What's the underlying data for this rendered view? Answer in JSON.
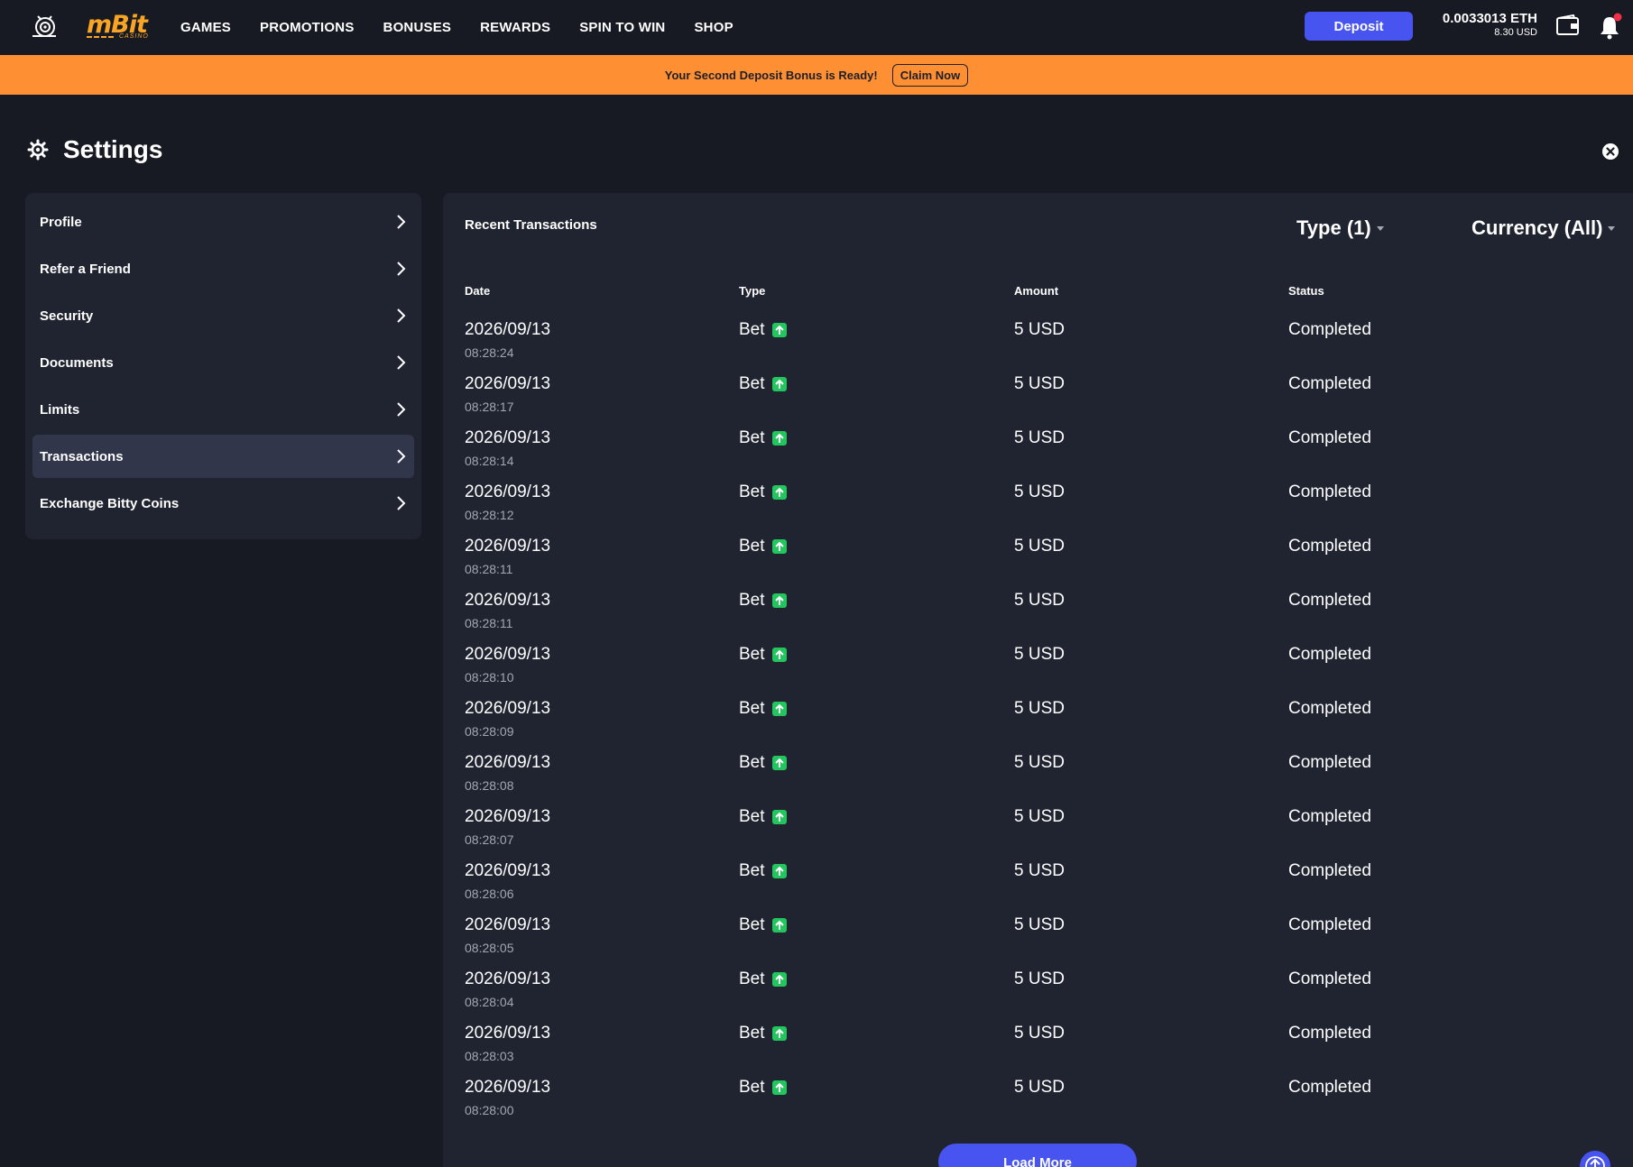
{
  "brand": {
    "logo_text": "mBit",
    "logo_sub": "CASINO",
    "accent": "#4754f0",
    "promo_color": "#ff8f33",
    "success": "#22c55e"
  },
  "nav": {
    "links": [
      "GAMES",
      "PROMOTIONS",
      "BONUSES",
      "REWARDS",
      "SPIN TO WIN",
      "SHOP"
    ],
    "deposit_label": "Deposit"
  },
  "balance": {
    "crypto": "0.0033013 ETH",
    "usd": "8.30 USD"
  },
  "promo": {
    "text": "Your Second Deposit Bonus is Ready!",
    "button": "Claim Now"
  },
  "page": {
    "title": "Settings"
  },
  "sidebar": {
    "items": [
      {
        "label": "Profile",
        "active": false
      },
      {
        "label": "Refer a Friend",
        "active": false
      },
      {
        "label": "Security",
        "active": false
      },
      {
        "label": "Documents",
        "active": false
      },
      {
        "label": "Limits",
        "active": false
      },
      {
        "label": "Transactions",
        "active": true
      },
      {
        "label": "Exchange Bitty Coins",
        "active": false
      }
    ]
  },
  "transactions": {
    "title": "Recent Transactions",
    "filter_type": "Type (1)",
    "filter_currency": "Currency (All)",
    "columns": {
      "date": "Date",
      "type": "Type",
      "amount": "Amount",
      "status": "Status"
    },
    "rows": [
      {
        "date": "2026/09/13",
        "time": "08:28:24",
        "type": "Bet",
        "amount": "5 USD",
        "status": "Completed"
      },
      {
        "date": "2026/09/13",
        "time": "08:28:17",
        "type": "Bet",
        "amount": "5 USD",
        "status": "Completed"
      },
      {
        "date": "2026/09/13",
        "time": "08:28:14",
        "type": "Bet",
        "amount": "5 USD",
        "status": "Completed"
      },
      {
        "date": "2026/09/13",
        "time": "08:28:12",
        "type": "Bet",
        "amount": "5 USD",
        "status": "Completed"
      },
      {
        "date": "2026/09/13",
        "time": "08:28:11",
        "type": "Bet",
        "amount": "5 USD",
        "status": "Completed"
      },
      {
        "date": "2026/09/13",
        "time": "08:28:11",
        "type": "Bet",
        "amount": "5 USD",
        "status": "Completed"
      },
      {
        "date": "2026/09/13",
        "time": "08:28:10",
        "type": "Bet",
        "amount": "5 USD",
        "status": "Completed"
      },
      {
        "date": "2026/09/13",
        "time": "08:28:09",
        "type": "Bet",
        "amount": "5 USD",
        "status": "Completed"
      },
      {
        "date": "2026/09/13",
        "time": "08:28:08",
        "type": "Bet",
        "amount": "5 USD",
        "status": "Completed"
      },
      {
        "date": "2026/09/13",
        "time": "08:28:07",
        "type": "Bet",
        "amount": "5 USD",
        "status": "Completed"
      },
      {
        "date": "2026/09/13",
        "time": "08:28:06",
        "type": "Bet",
        "amount": "5 USD",
        "status": "Completed"
      },
      {
        "date": "2026/09/13",
        "time": "08:28:05",
        "type": "Bet",
        "amount": "5 USD",
        "status": "Completed"
      },
      {
        "date": "2026/09/13",
        "time": "08:28:04",
        "type": "Bet",
        "amount": "5 USD",
        "status": "Completed"
      },
      {
        "date": "2026/09/13",
        "time": "08:28:03",
        "type": "Bet",
        "amount": "5 USD",
        "status": "Completed"
      },
      {
        "date": "2026/09/13",
        "time": "08:28:00",
        "type": "Bet",
        "amount": "5 USD",
        "status": "Completed"
      }
    ],
    "load_more": "Load More"
  },
  "icons": [
    "mascot-icon",
    "wallet-icon",
    "bell-icon",
    "gear-icon",
    "close-icon",
    "chevron-right-icon",
    "arrow-up-icon",
    "caret-down-icon",
    "scroll-top-icon"
  ]
}
